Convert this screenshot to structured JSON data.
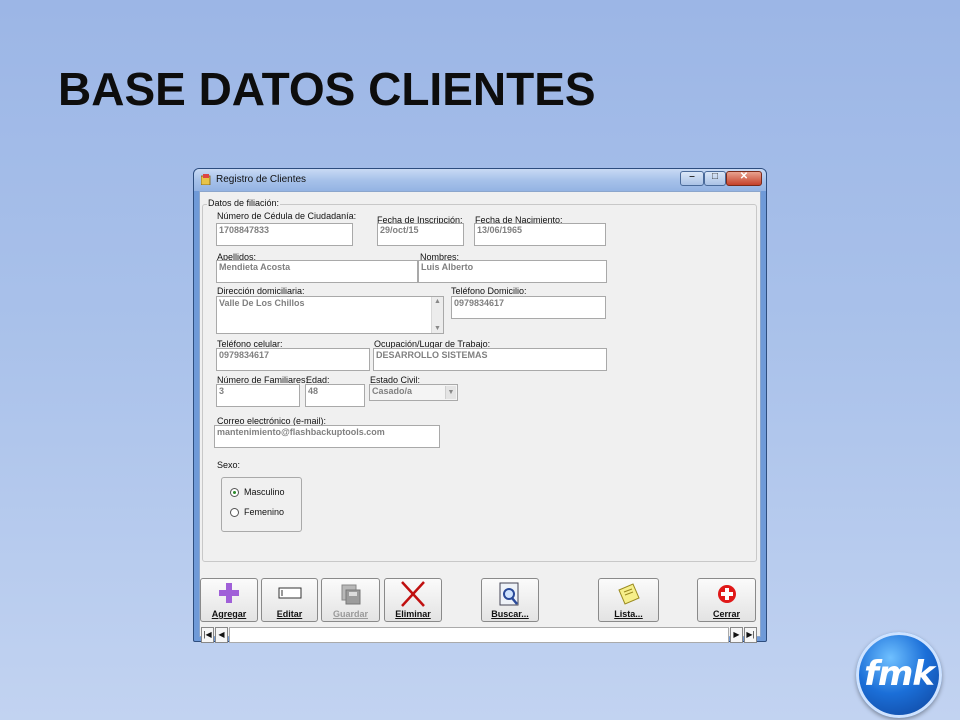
{
  "slide": {
    "title": "BASE DATOS CLIENTES"
  },
  "window": {
    "title": "Registro de Clientes"
  },
  "group": {
    "legend": "Datos de filiación:"
  },
  "fields": {
    "cedula": {
      "label": "Número de Cédula de Ciudadanía:",
      "value": "1708847833"
    },
    "fecha_inscripcion": {
      "label": "Fecha de  Inscripción:",
      "value": "29/oct/15"
    },
    "fecha_nacimiento": {
      "label": "Fecha de Nacimiento:",
      "value": "13/06/1965"
    },
    "apellidos": {
      "label": "Apellidos:",
      "value": "Mendieta Acosta"
    },
    "nombres": {
      "label": "Nombres:",
      "value": "Luis Alberto"
    },
    "direccion": {
      "label": "Dirección domiciliaria:",
      "value": "Valle De Los Chillos"
    },
    "telefono_domicilio": {
      "label": "Teléfono Domicilio:",
      "value": "0979834617"
    },
    "telefono_celular": {
      "label": "Teléfono celular:",
      "value": "0979834617"
    },
    "ocupacion": {
      "label": "Ocupación/Lugar de Trabajo:",
      "value": "DESARROLLO SISTEMAS"
    },
    "familiares": {
      "label": "Número de Familiares:",
      "value": "3"
    },
    "edad": {
      "label": "Edad:",
      "value": "48"
    },
    "estado_civil": {
      "label": "Estado Civil:",
      "value": "Casado/a"
    },
    "correo": {
      "label": "Correo electrónico (e-mail):",
      "value": "mantenimiento@flashbackuptools.com"
    }
  },
  "sexo": {
    "label": "Sexo:",
    "options": [
      "Masculino",
      "Femenino"
    ],
    "selected": "Masculino"
  },
  "toolbar": {
    "agregar": "Agregar",
    "editar": "Editar",
    "guardar": "Guardar",
    "eliminar": "Eliminar",
    "buscar": "Buscar...",
    "lista": "Lista...",
    "cerrar": "Cerrar"
  },
  "logo": {
    "text": "fmk"
  },
  "colors": {
    "accent": "#9b59d6",
    "close_red": "#e01818",
    "delete_red": "#c01010"
  }
}
